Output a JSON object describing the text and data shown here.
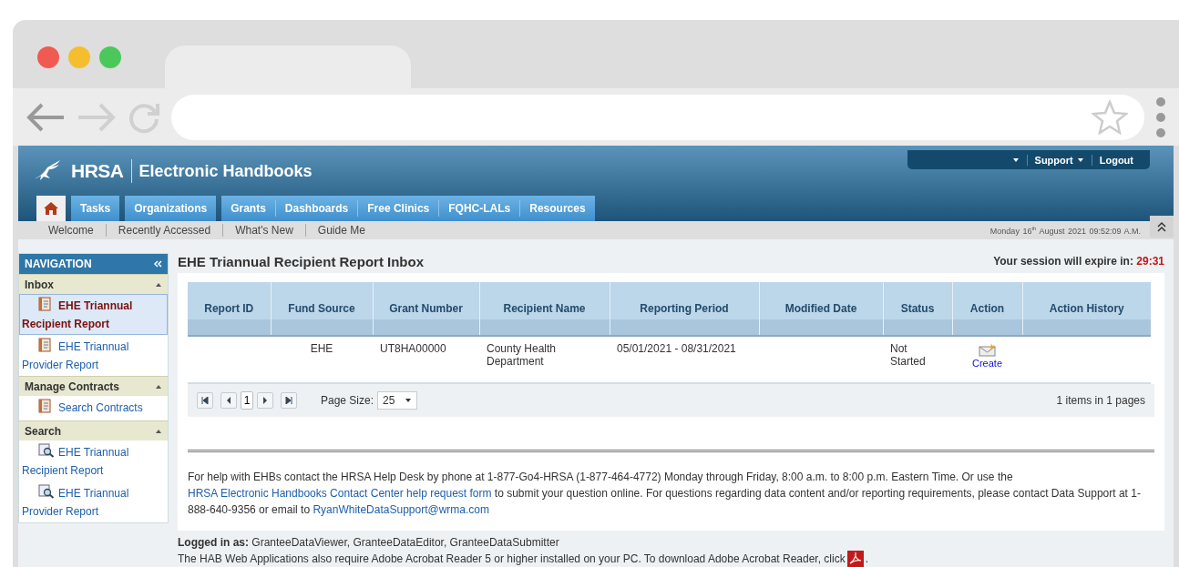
{
  "header": {
    "logo": "HRSA",
    "title": "Electronic Handbooks",
    "user_menu": [
      {
        "label": "Support",
        "dropdown": true
      },
      {
        "label": "Logout",
        "dropdown": false
      }
    ]
  },
  "main_tabs": [
    {
      "kind": "home",
      "selected": true
    },
    {
      "kind": "group_start",
      "label": "Tasks",
      "selected": false
    },
    {
      "kind": "group_start",
      "label": "Organizations",
      "selected": false
    },
    {
      "kind": "group_start",
      "label": "Grants",
      "selected": false
    },
    {
      "kind": "text",
      "label": "Dashboards",
      "selected": false
    },
    {
      "kind": "text",
      "label": "Free Clinics",
      "selected": false
    },
    {
      "kind": "text",
      "label": "FQHC-LALs",
      "selected": false
    },
    {
      "kind": "text",
      "label": "Resources",
      "selected": false
    }
  ],
  "sub_nav": [
    "Welcome",
    "Recently Accessed",
    "What's New",
    "Guide Me"
  ],
  "date": "Monday  16$^{th}$  August  2021  09:52:09  A.M.",
  "navigation": {
    "title": "NAVIGATION",
    "sections": [
      {
        "title": "Inbox",
        "expanded": true,
        "items": [
          {
            "label": "EHE Triannual Recipient Report",
            "kind": "report",
            "selected": true
          },
          {
            "label": "EHE Triannual Provider Report",
            "kind": "report",
            "selected": false
          }
        ]
      },
      {
        "title": "Manage Contracts",
        "expanded": true,
        "items": [
          {
            "label": "Search Contracts",
            "kind": "report",
            "selected": false
          }
        ]
      },
      {
        "title": "Search",
        "expanded": true,
        "items": [
          {
            "label": "EHE Triannual Recipient Report",
            "kind": "search",
            "selected": false
          },
          {
            "label": "EHE Triannual Provider Report",
            "kind": "search",
            "selected": false
          }
        ]
      }
    ]
  },
  "page_title": "EHE Triannual Recipient Report Inbox",
  "session": {
    "label": "Your session will expire in:",
    "time": "29:31"
  },
  "table": {
    "columns": [
      {
        "label": "Report ID",
        "kind": "text"
      },
      {
        "label": "Fund Source",
        "kind": "text"
      },
      {
        "label": "Grant Number",
        "kind": "text"
      },
      {
        "label": "Recipient Name",
        "kind": "text"
      },
      {
        "label": "Reporting Period",
        "kind": "text"
      },
      {
        "label": "Modified Date",
        "kind": "text"
      },
      {
        "label": "Status",
        "kind": "text"
      },
      {
        "label": "Action",
        "kind": "action"
      },
      {
        "label": "Action History",
        "kind": "text"
      }
    ],
    "rows": [
      {
        "cells": [
          null,
          "EHE",
          "UT8HA00000",
          "County Health Department",
          "05/01/2021 - 08/31/2021",
          null,
          "Not Started",
          null,
          null
        ],
        "action": "Create"
      }
    ]
  },
  "pager": {
    "current_page": "1",
    "page_size_label": "Page Size:",
    "page_size": "25",
    "summary": "1 items in 1 pages"
  },
  "help_text": [
    {
      "kind": "text",
      "text": "For help with EHBs contact the HRSA Help Desk by phone at 1-877-Go4-HRSA (1-877-464-4772) Monday through Friday, 8:00 a.m. to 8:00 p.m. Eastern Time. Or use the "
    },
    {
      "kind": "link",
      "text": "HRSA Electronic Handbooks Contact Center help request form"
    },
    {
      "kind": "text",
      "text": " to submit your question online. For questions regarding data content and/or reporting requirements, please contact Data Support at 1-888-640-9356 or email to "
    },
    {
      "kind": "link",
      "text": "RyanWhiteDataSupport@wrma.com"
    }
  ],
  "footer": {
    "logged_in_label": "Logged in as:",
    "logged_in_users": "GranteeDataViewer, GranteeDataEditor, GranteeDataSubmitter",
    "acrobat_note": "The HAB Web Applications also require Adobe Acrobat Reader 5 or higher installed on your PC. To download Adobe Acrobat Reader, click",
    "acrobat_end": "."
  }
}
